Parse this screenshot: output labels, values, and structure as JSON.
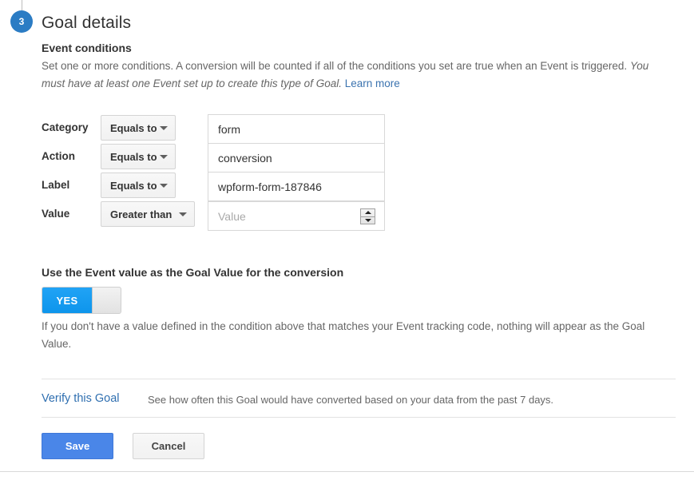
{
  "step": {
    "number": "3",
    "title": "Goal details"
  },
  "event_conditions": {
    "heading": "Event conditions",
    "description_part1": "Set one or more conditions. A conversion will be counted if all of the conditions you set are true when an Event is triggered. ",
    "description_italic": "You must have at least one Event set up to create this type of Goal.",
    "learn_more": "Learn more",
    "rows": [
      {
        "label": "Category",
        "match_type": "Equals to",
        "value": "form",
        "placeholder": ""
      },
      {
        "label": "Action",
        "match_type": "Equals to",
        "value": "conversion",
        "placeholder": ""
      },
      {
        "label": "Label",
        "match_type": "Equals to",
        "value": "wpform-form-187846",
        "placeholder": ""
      },
      {
        "label": "Value",
        "match_type": "Greater than",
        "value": "",
        "placeholder": "Value"
      }
    ]
  },
  "event_value": {
    "heading": "Use the Event value as the Goal Value for the conversion",
    "toggle_state": "YES",
    "help_text": "If you don't have a value defined in the condition above that matches your Event tracking code, nothing will appear as the Goal Value."
  },
  "verify": {
    "link_label": "Verify this Goal",
    "description": "See how often this Goal would have converted based on your data from the past 7 days."
  },
  "actions": {
    "save_label": "Save",
    "cancel_label": "Cancel"
  },
  "colors": {
    "accent_blue": "#4a86e8",
    "badge_blue": "#2b7cc4",
    "toggle_blue": "#0d95ec",
    "link_blue": "#3b73af"
  }
}
